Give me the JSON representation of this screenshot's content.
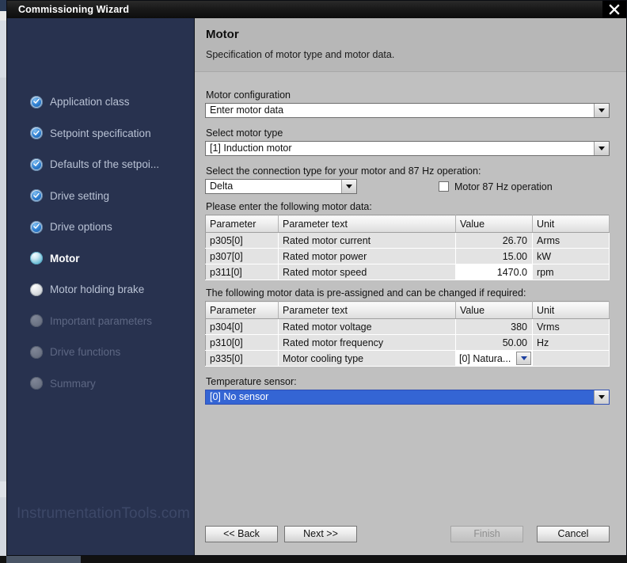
{
  "window": {
    "title": "Commissioning Wizard",
    "close_icon": "close-icon"
  },
  "sidebar": {
    "watermark": "InstrumentationTools.com",
    "items": [
      {
        "label": "Application class",
        "state": "done"
      },
      {
        "label": "Setpoint specification",
        "state": "done"
      },
      {
        "label": "Defaults of the setpoi...",
        "state": "done"
      },
      {
        "label": "Drive setting",
        "state": "done"
      },
      {
        "label": "Drive options",
        "state": "done"
      },
      {
        "label": "Motor",
        "state": "current"
      },
      {
        "label": "Motor holding brake",
        "state": "pending"
      },
      {
        "label": "Important parameters",
        "state": "disabled"
      },
      {
        "label": "Drive functions",
        "state": "disabled"
      },
      {
        "label": "Summary",
        "state": "disabled"
      }
    ]
  },
  "panel": {
    "title": "Motor",
    "subtitle": "Specification of motor type and motor data.",
    "motor_configuration": {
      "label": "Motor configuration",
      "value": "Enter motor data"
    },
    "motor_type": {
      "label": "Select motor type",
      "value": "[1] Induction motor"
    },
    "connection": {
      "label": "Select the connection type for your motor and 87 Hz operation:",
      "value": "Delta",
      "checkbox_label": "Motor 87 Hz operation",
      "checkbox_checked": false
    },
    "table1": {
      "caption": "Please enter the following motor data:",
      "headers": [
        "Parameter",
        "Parameter text",
        "Value",
        "Unit"
      ],
      "rows": [
        {
          "parameter": "p305[0]",
          "text": "Rated motor current",
          "value": "26.70",
          "unit": "Arms",
          "editable": false
        },
        {
          "parameter": "p307[0]",
          "text": "Rated motor power",
          "value": "15.00",
          "unit": "kW",
          "editable": false
        },
        {
          "parameter": "p311[0]",
          "text": "Rated motor speed",
          "value": "1470.0",
          "unit": "rpm",
          "editable": true
        }
      ]
    },
    "table2": {
      "caption": "The following motor data is pre-assigned and can be changed if required:",
      "headers": [
        "Parameter",
        "Parameter text",
        "Value",
        "Unit"
      ],
      "rows": [
        {
          "parameter": "p304[0]",
          "text": "Rated motor voltage",
          "value": "380",
          "unit": "Vrms",
          "type": "text"
        },
        {
          "parameter": "p310[0]",
          "text": "Rated motor frequency",
          "value": "50.00",
          "unit": "Hz",
          "type": "text"
        },
        {
          "parameter": "p335[0]",
          "text": "Motor cooling type",
          "value": "[0] Natura...",
          "unit": "",
          "type": "combo"
        }
      ]
    },
    "temperature_sensor": {
      "label": "Temperature sensor:",
      "value": "[0] No sensor"
    }
  },
  "footer": {
    "back": "<< Back",
    "next": "Next >>",
    "finish": "Finish",
    "cancel": "Cancel"
  }
}
